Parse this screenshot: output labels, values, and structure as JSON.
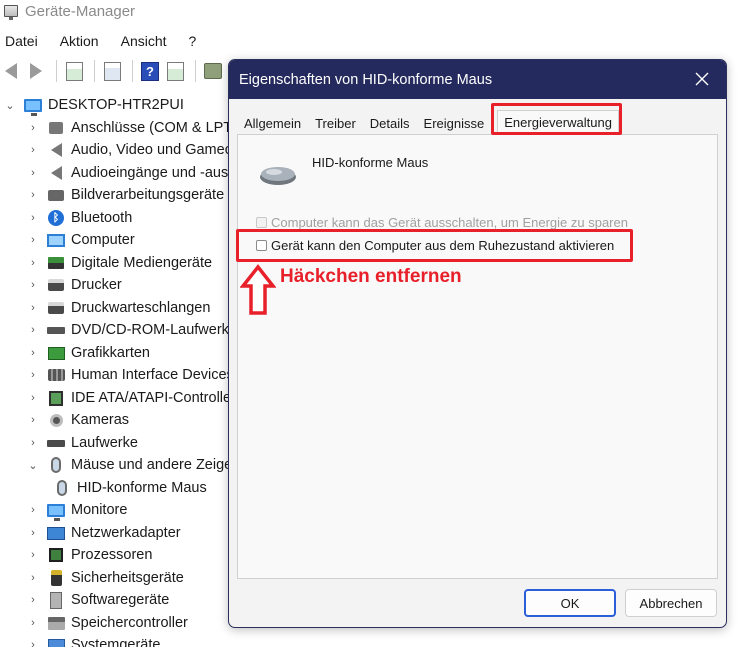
{
  "device_manager": {
    "window_title": "Geräte-Manager",
    "menu": [
      "Datei",
      "Aktion",
      "Ansicht",
      "?"
    ],
    "toolbar": {
      "icons": [
        "back-arrow-icon",
        "forward-arrow-icon",
        "properties-icon",
        "update-driver-icon",
        "help-icon",
        "show-hidden-icon",
        "scan-hardware-icon"
      ],
      "help_label": "?"
    },
    "tree": {
      "root": "DESKTOP-HTR2PUI",
      "items": [
        {
          "label": "Anschlüsse (COM & LPT)",
          "icon": "port-icon"
        },
        {
          "label": "Audio, Video und Gamecontroller",
          "icon": "speaker-icon"
        },
        {
          "label": "Audioeingänge und -ausgänge",
          "icon": "audio-io-icon"
        },
        {
          "label": "Bildverarbeitungsgeräte",
          "icon": "camera-icon"
        },
        {
          "label": "Bluetooth",
          "icon": "bluetooth-icon",
          "glyph": "ᛒ"
        },
        {
          "label": "Computer",
          "icon": "computer-icon"
        },
        {
          "label": "Digitale Mediengeräte",
          "icon": "media-device-icon"
        },
        {
          "label": "Drucker",
          "icon": "printer-icon"
        },
        {
          "label": "Druckwarteschlangen",
          "icon": "print-queue-icon"
        },
        {
          "label": "DVD/CD-ROM-Laufwerke",
          "icon": "disc-drive-icon"
        },
        {
          "label": "Grafikkarten",
          "icon": "display-adapter-icon"
        },
        {
          "label": "Human Interface Devices",
          "icon": "hid-icon"
        },
        {
          "label": "IDE ATA/ATAPI-Controller",
          "icon": "ide-controller-icon"
        },
        {
          "label": "Kameras",
          "icon": "webcam-icon"
        },
        {
          "label": "Laufwerke",
          "icon": "drive-icon"
        },
        {
          "label": "Mäuse und andere Zeigegeräte",
          "icon": "mouse-icon",
          "expanded": true
        },
        {
          "label": "HID-konforme Maus",
          "icon": "mouse-icon",
          "child": true
        },
        {
          "label": "Monitore",
          "icon": "monitor-icon"
        },
        {
          "label": "Netzwerkadapter",
          "icon": "network-adapter-icon"
        },
        {
          "label": "Prozessoren",
          "icon": "processor-icon"
        },
        {
          "label": "Sicherheitsgeräte",
          "icon": "security-device-icon"
        },
        {
          "label": "Softwaregeräte",
          "icon": "software-device-icon"
        },
        {
          "label": "Speichercontroller",
          "icon": "storage-controller-icon"
        },
        {
          "label": "Systemgeräte",
          "icon": "system-device-icon"
        }
      ]
    }
  },
  "dialog": {
    "title": "Eigenschaften von HID-konforme Maus",
    "close_glyph": "✕",
    "tabs": [
      "Allgemein",
      "Treiber",
      "Details",
      "Ereignisse",
      "Energieverwaltung"
    ],
    "active_tab": "Energieverwaltung",
    "device_name": "HID-konforme Maus",
    "options": [
      {
        "label": "Computer kann das Gerät ausschalten, um Energie zu sparen",
        "checked": false,
        "enabled": false
      },
      {
        "label": "Gerät kann den Computer aus dem Ruhezustand aktivieren",
        "checked": false,
        "enabled": true
      }
    ],
    "buttons": {
      "ok": "OK",
      "cancel": "Abbrechen"
    }
  },
  "annotation": {
    "text": "Häckchen entfernen",
    "color": "#e8202a"
  },
  "colors": {
    "dialog_titlebar": "#242a5e",
    "highlight": "#e8202a",
    "ok_button_border": "#2b5fd9"
  }
}
